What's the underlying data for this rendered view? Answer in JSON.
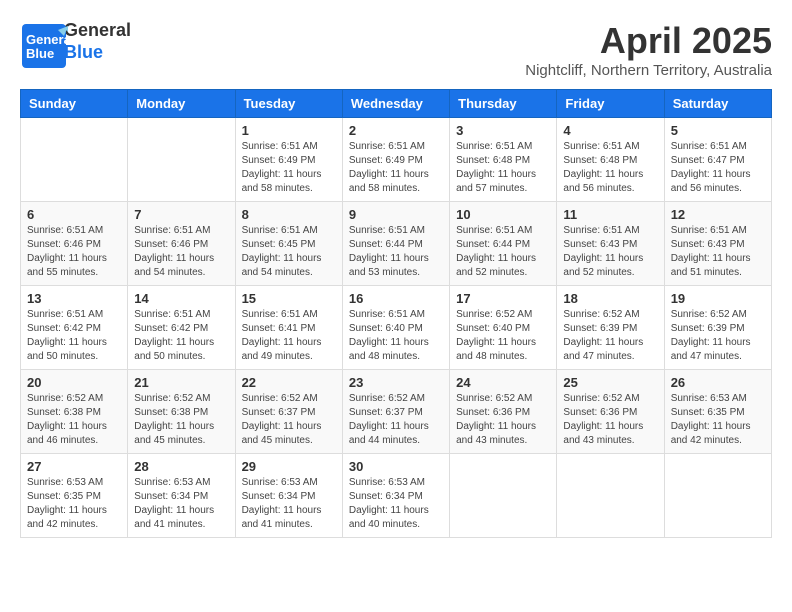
{
  "header": {
    "logo_general": "General",
    "logo_blue": "Blue",
    "month_title": "April 2025",
    "subtitle": "Nightcliff, Northern Territory, Australia"
  },
  "days_of_week": [
    "Sunday",
    "Monday",
    "Tuesday",
    "Wednesday",
    "Thursday",
    "Friday",
    "Saturday"
  ],
  "weeks": [
    [
      {
        "day": "",
        "info": ""
      },
      {
        "day": "",
        "info": ""
      },
      {
        "day": "1",
        "sunrise": "6:51 AM",
        "sunset": "6:49 PM",
        "daylight": "11 hours and 58 minutes."
      },
      {
        "day": "2",
        "sunrise": "6:51 AM",
        "sunset": "6:49 PM",
        "daylight": "11 hours and 58 minutes."
      },
      {
        "day": "3",
        "sunrise": "6:51 AM",
        "sunset": "6:48 PM",
        "daylight": "11 hours and 57 minutes."
      },
      {
        "day": "4",
        "sunrise": "6:51 AM",
        "sunset": "6:48 PM",
        "daylight": "11 hours and 56 minutes."
      },
      {
        "day": "5",
        "sunrise": "6:51 AM",
        "sunset": "6:47 PM",
        "daylight": "11 hours and 56 minutes."
      }
    ],
    [
      {
        "day": "6",
        "sunrise": "6:51 AM",
        "sunset": "6:46 PM",
        "daylight": "11 hours and 55 minutes."
      },
      {
        "day": "7",
        "sunrise": "6:51 AM",
        "sunset": "6:46 PM",
        "daylight": "11 hours and 54 minutes."
      },
      {
        "day": "8",
        "sunrise": "6:51 AM",
        "sunset": "6:45 PM",
        "daylight": "11 hours and 54 minutes."
      },
      {
        "day": "9",
        "sunrise": "6:51 AM",
        "sunset": "6:44 PM",
        "daylight": "11 hours and 53 minutes."
      },
      {
        "day": "10",
        "sunrise": "6:51 AM",
        "sunset": "6:44 PM",
        "daylight": "11 hours and 52 minutes."
      },
      {
        "day": "11",
        "sunrise": "6:51 AM",
        "sunset": "6:43 PM",
        "daylight": "11 hours and 52 minutes."
      },
      {
        "day": "12",
        "sunrise": "6:51 AM",
        "sunset": "6:43 PM",
        "daylight": "11 hours and 51 minutes."
      }
    ],
    [
      {
        "day": "13",
        "sunrise": "6:51 AM",
        "sunset": "6:42 PM",
        "daylight": "11 hours and 50 minutes."
      },
      {
        "day": "14",
        "sunrise": "6:51 AM",
        "sunset": "6:42 PM",
        "daylight": "11 hours and 50 minutes."
      },
      {
        "day": "15",
        "sunrise": "6:51 AM",
        "sunset": "6:41 PM",
        "daylight": "11 hours and 49 minutes."
      },
      {
        "day": "16",
        "sunrise": "6:51 AM",
        "sunset": "6:40 PM",
        "daylight": "11 hours and 48 minutes."
      },
      {
        "day": "17",
        "sunrise": "6:52 AM",
        "sunset": "6:40 PM",
        "daylight": "11 hours and 48 minutes."
      },
      {
        "day": "18",
        "sunrise": "6:52 AM",
        "sunset": "6:39 PM",
        "daylight": "11 hours and 47 minutes."
      },
      {
        "day": "19",
        "sunrise": "6:52 AM",
        "sunset": "6:39 PM",
        "daylight": "11 hours and 47 minutes."
      }
    ],
    [
      {
        "day": "20",
        "sunrise": "6:52 AM",
        "sunset": "6:38 PM",
        "daylight": "11 hours and 46 minutes."
      },
      {
        "day": "21",
        "sunrise": "6:52 AM",
        "sunset": "6:38 PM",
        "daylight": "11 hours and 45 minutes."
      },
      {
        "day": "22",
        "sunrise": "6:52 AM",
        "sunset": "6:37 PM",
        "daylight": "11 hours and 45 minutes."
      },
      {
        "day": "23",
        "sunrise": "6:52 AM",
        "sunset": "6:37 PM",
        "daylight": "11 hours and 44 minutes."
      },
      {
        "day": "24",
        "sunrise": "6:52 AM",
        "sunset": "6:36 PM",
        "daylight": "11 hours and 43 minutes."
      },
      {
        "day": "25",
        "sunrise": "6:52 AM",
        "sunset": "6:36 PM",
        "daylight": "11 hours and 43 minutes."
      },
      {
        "day": "26",
        "sunrise": "6:53 AM",
        "sunset": "6:35 PM",
        "daylight": "11 hours and 42 minutes."
      }
    ],
    [
      {
        "day": "27",
        "sunrise": "6:53 AM",
        "sunset": "6:35 PM",
        "daylight": "11 hours and 42 minutes."
      },
      {
        "day": "28",
        "sunrise": "6:53 AM",
        "sunset": "6:34 PM",
        "daylight": "11 hours and 41 minutes."
      },
      {
        "day": "29",
        "sunrise": "6:53 AM",
        "sunset": "6:34 PM",
        "daylight": "11 hours and 41 minutes."
      },
      {
        "day": "30",
        "sunrise": "6:53 AM",
        "sunset": "6:34 PM",
        "daylight": "11 hours and 40 minutes."
      },
      {
        "day": "",
        "info": ""
      },
      {
        "day": "",
        "info": ""
      },
      {
        "day": "",
        "info": ""
      }
    ]
  ]
}
